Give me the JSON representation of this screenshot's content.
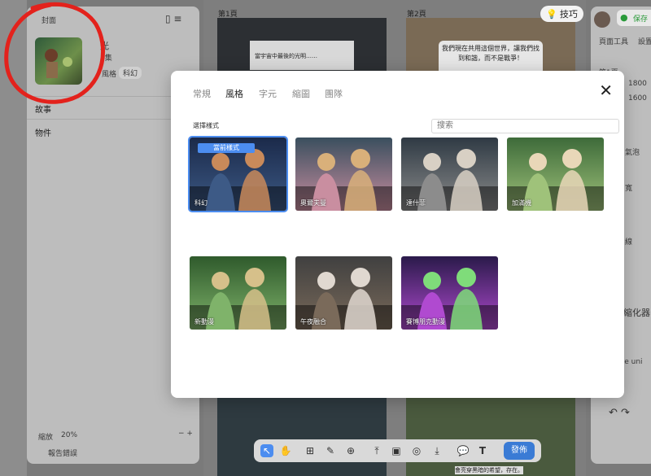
{
  "left_panel": {
    "cover_label": "封面",
    "title_fragment": "光",
    "subtitle_fragment": "1集",
    "style_label": "風格",
    "style_value": "科幻",
    "nav_story": "故事",
    "nav_objects": "物件",
    "zoom_label": "縮放",
    "zoom_value": "20%",
    "report_label": "報告錯誤"
  },
  "canvas": {
    "page1_label": "第1頁",
    "page2_label": "第2頁",
    "page1_caption": "當宇宙中最後的光明……",
    "page2_bubble": "我們現在共用這個世界，讓我們找到和諧，而不是戰爭！",
    "bottom_caption": "會亮穿黑暗的希望，存在。"
  },
  "tip_button": {
    "label": "技巧"
  },
  "right_panel": {
    "save_label": "保存",
    "tab_page_tools": "頁面工具",
    "tab_settings": "設置",
    "page_label": "第1頁",
    "num_1800": "1800",
    "num_1600": "1600",
    "frag_bubble": "氣泡",
    "frag_width": "寬",
    "frag_line": "線",
    "frag_shrink": "縮化器",
    "frag_text": "the uni"
  },
  "modal": {
    "tabs": [
      "常規",
      "風格",
      "字元",
      "縮圖",
      "團隊"
    ],
    "active_tab_index": 1,
    "section_label": "選擇樣式",
    "search_placeholder": "搜索",
    "current_badge": "當前樣式",
    "styles": [
      {
        "label": "科幻",
        "selected": true,
        "colors": [
          "#1b2a4a",
          "#3d5a86",
          "#c98a5a"
        ]
      },
      {
        "label": "奧爾夫曼",
        "selected": false,
        "colors": [
          "#3a4f5e",
          "#c98ea0",
          "#d9b07a"
        ]
      },
      {
        "label": "達什菲",
        "selected": false,
        "colors": [
          "#2f3a44",
          "#8c8c8c",
          "#d8d0c4"
        ]
      },
      {
        "label": "加滿機",
        "selected": false,
        "colors": [
          "#3e6b3a",
          "#9fc27a",
          "#e9d7b8"
        ]
      },
      {
        "label": "新動漫",
        "selected": false,
        "colors": [
          "#2f5a2c",
          "#7fb36a",
          "#d6c08a"
        ]
      },
      {
        "label": "午夜融合",
        "selected": false,
        "colors": [
          "#404040",
          "#7a6a5a",
          "#e0d8d0"
        ]
      },
      {
        "label": "賽博朋克動漫",
        "selected": false,
        "colors": [
          "#2a1a4a",
          "#b04ad0",
          "#7fdc7a"
        ]
      }
    ]
  },
  "toolbar": {
    "publish_label": "發佈"
  },
  "colors": {
    "accent": "#4c8df0",
    "publish": "#3a7bd5",
    "annotation_red": "#e3221c"
  }
}
